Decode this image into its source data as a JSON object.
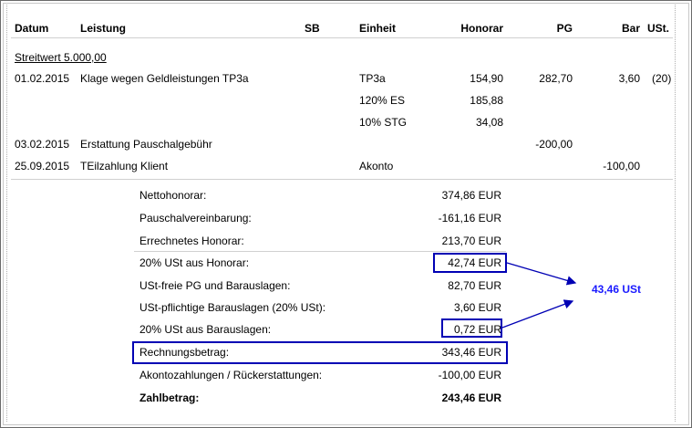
{
  "header": {
    "datum": "Datum",
    "leistung": "Leistung",
    "sb": "SB",
    "einheit": "Einheit",
    "honorar": "Honorar",
    "pg": "PG",
    "bar": "Bar",
    "ust": "USt."
  },
  "streitwert": "Streitwert 5.000,00",
  "rows": [
    {
      "datum": "01.02.2015",
      "leistung": "Klage wegen Geldleistungen TP3a",
      "einheit": "TP3a",
      "honorar": "154,90",
      "pg": "282,70",
      "bar": "3,60",
      "ust": "(20)"
    },
    {
      "datum": "",
      "leistung": "",
      "einheit": "120% ES",
      "honorar": "185,88",
      "pg": "",
      "bar": "",
      "ust": ""
    },
    {
      "datum": "",
      "leistung": "",
      "einheit": "10% STG",
      "honorar": "34,08",
      "pg": "",
      "bar": "",
      "ust": ""
    },
    {
      "datum": "03.02.2015",
      "leistung": "Erstattung Pauschalgebühr",
      "einheit": "",
      "honorar": "",
      "pg": "-200,00",
      "bar": "",
      "ust": ""
    },
    {
      "datum": "25.09.2015",
      "leistung": "TEilzahlung Klient",
      "einheit": "Akonto",
      "honorar": "",
      "pg": "",
      "bar": "-100,00",
      "ust": ""
    }
  ],
  "summary": [
    {
      "label": "Nettohonorar:",
      "value": "374,86 EUR"
    },
    {
      "label": "Pauschalvereinbarung:",
      "value": "-161,16 EUR"
    },
    {
      "label": "Errechnetes Honorar:",
      "value": "213,70 EUR"
    },
    {
      "label": "20% USt aus Honorar:",
      "value": "42,74 EUR"
    },
    {
      "label": "USt-freie PG und Barauslagen:",
      "value": "82,70 EUR"
    },
    {
      "label": "USt-pflichtige Barauslagen (20% USt):",
      "value": "3,60 EUR"
    },
    {
      "label": "20% USt aus Barauslagen:",
      "value": "0,72 EUR"
    },
    {
      "label": "Rechnungsbetrag:",
      "value": "343,46 EUR"
    },
    {
      "label": "Akontozahlungen / Rückerstattungen:",
      "value": "-100,00 EUR"
    },
    {
      "label": "Zahlbetrag:",
      "value": "243,46 EUR"
    }
  ],
  "annotation": {
    "ust_total": "43,46 USt",
    "color": "#0000b4"
  }
}
